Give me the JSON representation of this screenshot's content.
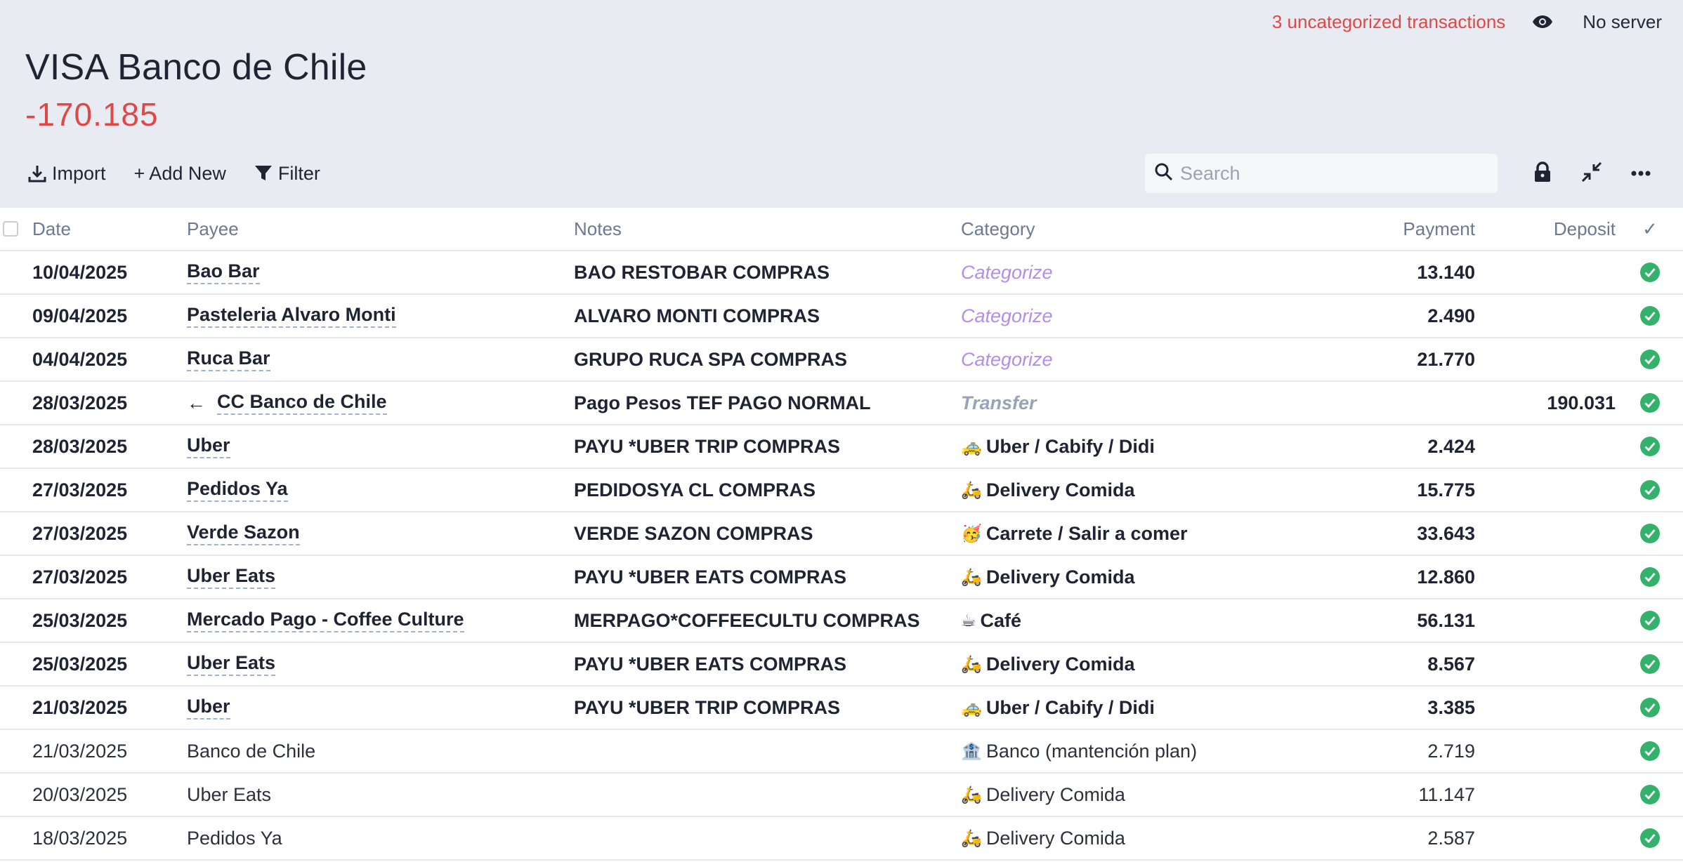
{
  "topbar": {
    "uncategorized": "3 uncategorized transactions",
    "server": "No server"
  },
  "account": {
    "name": "VISA Banco de Chile",
    "balance": "-170.185"
  },
  "toolbar": {
    "import_label": "Import",
    "add_new_label": "+ Add New",
    "filter_label": "Filter",
    "search_placeholder": "Search"
  },
  "columns": {
    "date": "Date",
    "payee": "Payee",
    "notes": "Notes",
    "category": "Category",
    "payment": "Payment",
    "deposit": "Deposit",
    "cleared": "✓"
  },
  "transactions": [
    {
      "date": "10/04/2025",
      "payee": "Bao Bar",
      "notes": "BAO RESTOBAR COMPRAS",
      "category": "Categorize",
      "emoji": "",
      "payment": "13.140",
      "deposit": ""
    },
    {
      "date": "09/04/2025",
      "payee": "Pasteleria Alvaro Monti",
      "notes": "ALVARO MONTI COMPRAS",
      "category": "Categorize",
      "emoji": "",
      "payment": "2.490",
      "deposit": ""
    },
    {
      "date": "04/04/2025",
      "payee": "Ruca Bar",
      "notes": "GRUPO RUCA SPA COMPRAS",
      "category": "Categorize",
      "emoji": "",
      "payment": "21.770",
      "deposit": ""
    },
    {
      "date": "28/03/2025",
      "payee": "CC Banco de Chile",
      "notes": "Pago Pesos TEF PAGO NORMAL",
      "category": "Transfer",
      "emoji": "",
      "payment": "",
      "deposit": "190.031",
      "arrow": "←"
    },
    {
      "date": "28/03/2025",
      "payee": "Uber",
      "notes": "PAYU *UBER TRIP COMPRAS",
      "category": "Uber / Cabify / Didi",
      "emoji": "🚕",
      "payment": "2.424",
      "deposit": ""
    },
    {
      "date": "27/03/2025",
      "payee": "Pedidos Ya",
      "notes": "PEDIDOSYA CL COMPRAS",
      "category": "Delivery Comida",
      "emoji": "🛵",
      "payment": "15.775",
      "deposit": ""
    },
    {
      "date": "27/03/2025",
      "payee": "Verde Sazon",
      "notes": "VERDE SAZON COMPRAS",
      "category": "Carrete / Salir a comer",
      "emoji": "🥳",
      "payment": "33.643",
      "deposit": ""
    },
    {
      "date": "27/03/2025",
      "payee": "Uber Eats",
      "notes": "PAYU *UBER EATS COMPRAS",
      "category": "Delivery Comida",
      "emoji": "🛵",
      "payment": "12.860",
      "deposit": ""
    },
    {
      "date": "25/03/2025",
      "payee": "Mercado Pago - Coffee Culture",
      "notes": "MERPAGO*COFFEECULTU COMPRAS",
      "category": "Café",
      "emoji": "☕",
      "payment": "56.131",
      "deposit": ""
    },
    {
      "date": "25/03/2025",
      "payee": "Uber Eats",
      "notes": "PAYU *UBER EATS COMPRAS",
      "category": "Delivery Comida",
      "emoji": "🛵",
      "payment": "8.567",
      "deposit": ""
    },
    {
      "date": "21/03/2025",
      "payee": "Uber",
      "notes": "PAYU *UBER TRIP COMPRAS",
      "category": "Uber / Cabify / Didi",
      "emoji": "🚕",
      "payment": "3.385",
      "deposit": ""
    },
    {
      "date": "21/03/2025",
      "payee": "Banco de Chile",
      "notes": "",
      "category": "Banco (mantención plan)",
      "emoji": "🏦",
      "payment": "2.719",
      "deposit": ""
    },
    {
      "date": "20/03/2025",
      "payee": "Uber Eats",
      "notes": "",
      "category": "Delivery Comida",
      "emoji": "🛵",
      "payment": "11.147",
      "deposit": ""
    },
    {
      "date": "18/03/2025",
      "payee": "Pedidos Ya",
      "notes": "",
      "category": "Delivery Comida",
      "emoji": "🛵",
      "payment": "2.587",
      "deposit": ""
    }
  ],
  "colors": {
    "negative": "#e04848",
    "categorize": "#b38ee8",
    "cleared": "#34b16a"
  }
}
